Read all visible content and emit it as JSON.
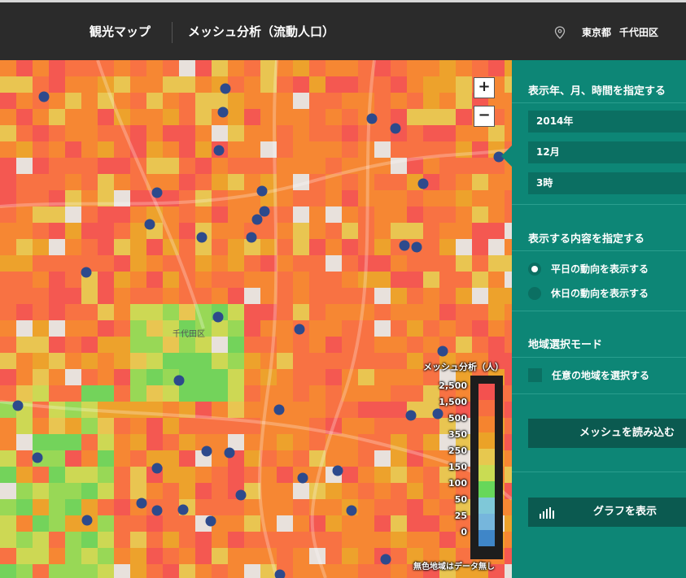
{
  "header": {
    "app_title": "観光マップ",
    "page_title": "メッシュ分析（流動人口）",
    "location_prefecture": "東京都",
    "location_ward": "千代田区",
    "location_icon": "map-pin-icon"
  },
  "map": {
    "zoom_in_label": "+",
    "zoom_out_label": "−",
    "place_label": "千代田区",
    "legend": {
      "title": "メッシュ分析（人）",
      "note": "無色地域はデータ無し",
      "bins": [
        {
          "label": "2,500",
          "color": "#f3514f"
        },
        {
          "label": "1,500",
          "color": "#f76e40"
        },
        {
          "label": "500",
          "color": "#f5842f"
        },
        {
          "label": "350",
          "color": "#eba227"
        },
        {
          "label": "250",
          "color": "#e7c84f"
        },
        {
          "label": "150",
          "color": "#c9dc53"
        },
        {
          "label": "100",
          "color": "#67d75a"
        },
        {
          "label": "50",
          "color": "#7fc8d8"
        },
        {
          "label": "25",
          "color": "#76b6dc"
        },
        {
          "label": "0",
          "color": "#3f86c8"
        }
      ]
    }
  },
  "panel": {
    "time_section_title": "表示年、月、時間を指定する",
    "year": "2014年",
    "month": "12月",
    "hour": "3時",
    "content_section_title": "表示する内容を指定する",
    "radio_weekday": "平日の動向を表示する",
    "radio_holiday": "休日の動向を表示する",
    "selected_radio": "weekday",
    "region_section_title": "地域選択モード",
    "checkbox_region": "任意の地域を選択する",
    "load_button": "メッシュを読み込む",
    "graph_button": "グラフを表示",
    "graph_icon": "bar-chart-icon"
  },
  "colors": {
    "header_bg": "#2b2b2b",
    "panel_bg": "#0d8676",
    "marker": "#2d4a8c"
  }
}
